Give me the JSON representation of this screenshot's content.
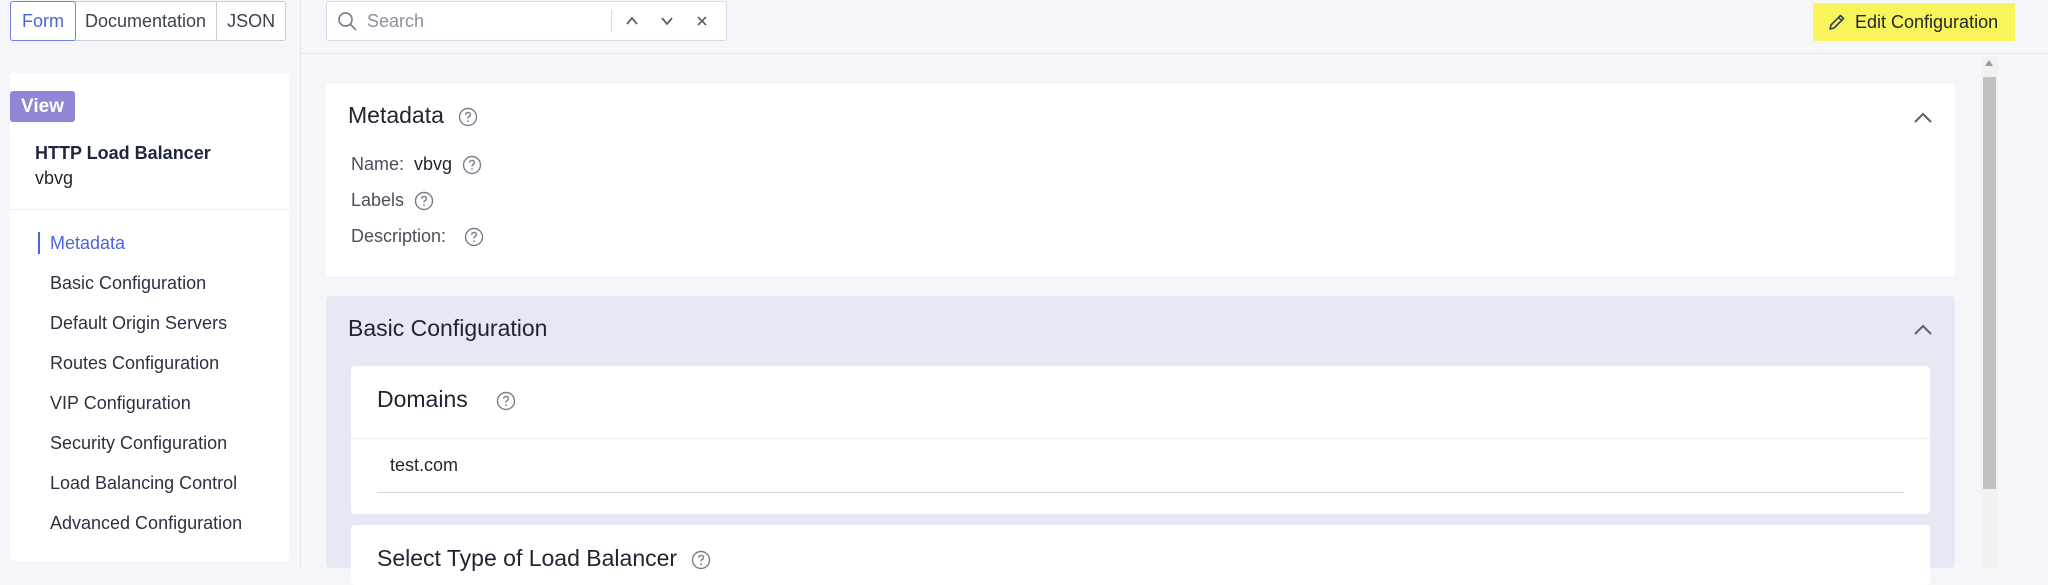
{
  "view_tabs": [
    {
      "label": "Form",
      "active": true
    },
    {
      "label": "Documentation",
      "active": false
    },
    {
      "label": "JSON",
      "active": false
    }
  ],
  "search": {
    "placeholder": "Search",
    "icon": "search-icon",
    "up_icon": "chevron-up-icon",
    "down_icon": "chevron-down-icon",
    "clear_icon": "close-icon"
  },
  "edit_button": {
    "label": "Edit Configuration",
    "icon": "pencil-icon",
    "highlight_color": "#f7f55a"
  },
  "sidebar": {
    "badge": "View",
    "object_kind": "HTTP Load Balancer",
    "object_name": "vbvg",
    "items": [
      {
        "label": "Metadata",
        "active": true
      },
      {
        "label": "Basic Configuration",
        "active": false
      },
      {
        "label": "Default Origin Servers",
        "active": false
      },
      {
        "label": "Routes Configuration",
        "active": false
      },
      {
        "label": "VIP Configuration",
        "active": false
      },
      {
        "label": "Security Configuration",
        "active": false
      },
      {
        "label": "Load Balancing Control",
        "active": false
      },
      {
        "label": "Advanced Configuration",
        "active": false
      }
    ]
  },
  "metadata_section": {
    "title": "Metadata",
    "name_label": "Name:",
    "name_value": "vbvg",
    "labels_label": "Labels",
    "description_label": "Description:"
  },
  "basic_section": {
    "title": "Basic Configuration",
    "domains_title": "Domains",
    "domains": [
      "test.com"
    ],
    "lb_type_title": "Select Type of Load Balancer"
  },
  "colors": {
    "accent": "#4b66d8",
    "badge": "#8f86d6",
    "section_bg": "#e6e8f3"
  }
}
